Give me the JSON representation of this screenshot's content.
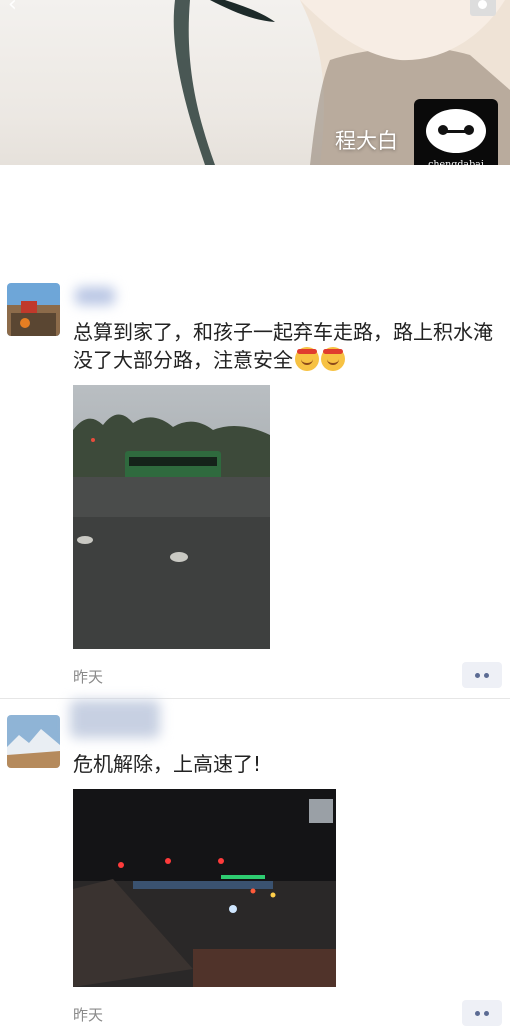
{
  "profile": {
    "name": "程大白",
    "avatar_text": "chengdabai"
  },
  "posts": [
    {
      "text": "总算到家了，和孩子一起弃车走路，路上积水淹没了大部分路，注意安全",
      "emoji_count": 2,
      "timestamp": "昨天"
    },
    {
      "text": "危机解除，上高速了!",
      "timestamp": "昨天"
    }
  ]
}
